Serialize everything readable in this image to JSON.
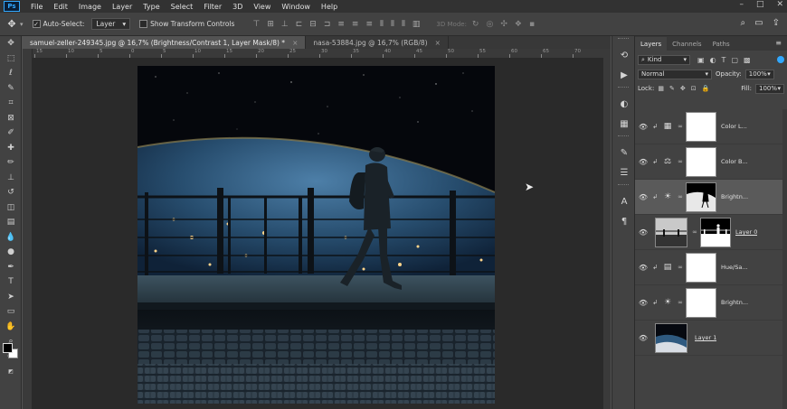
{
  "app": {
    "menu": [
      "File",
      "Edit",
      "Image",
      "Layer",
      "Type",
      "Select",
      "Filter",
      "3D",
      "View",
      "Window",
      "Help"
    ],
    "logo": "Ps"
  },
  "options": {
    "auto_select_label": "Auto-Select:",
    "auto_select_value": "Layer",
    "show_transform_label": "Show Transform Controls",
    "mode_3d_label": "3D Mode:"
  },
  "tabs": [
    {
      "label": "samuel-zeller-249345.jpg @ 16,7% (Brightness/Contrast 1, Layer Mask/8) *",
      "close": "×"
    },
    {
      "label": "nasa-53884.jpg @ 16,7% (RGB/8)",
      "close": "×"
    }
  ],
  "ruler": [
    "15",
    "10",
    "5",
    "0",
    "5",
    "10",
    "15",
    "20",
    "25",
    "30",
    "35",
    "40",
    "45",
    "50",
    "55",
    "60",
    "65",
    "70",
    "75"
  ],
  "panel": {
    "tabs": [
      "Layers",
      "Channels",
      "Paths"
    ],
    "filter_kind": "Kind",
    "blend_mode": "Normal",
    "opacity_label": "Opacity:",
    "opacity_value": "100%",
    "lock_label": "Lock:",
    "fill_label": "Fill:",
    "fill_value": "100%"
  },
  "layers": [
    {
      "name": "Color L...",
      "type": "adjustment",
      "icon": "color-lookup-icon",
      "clipped": true
    },
    {
      "name": "Color B...",
      "type": "adjustment",
      "icon": "color-balance-icon",
      "clipped": true
    },
    {
      "name": "Brightn...",
      "type": "adjustment",
      "icon": "brightness-icon",
      "clipped": true,
      "selected": true
    },
    {
      "name": "Layer 0",
      "type": "pixel",
      "icon": "",
      "clipped": false
    },
    {
      "name": "Hue/Sa...",
      "type": "adjustment",
      "icon": "hue-saturation-icon",
      "clipped": true
    },
    {
      "name": "Brightn...",
      "type": "adjustment",
      "icon": "brightness-icon",
      "clipped": true
    },
    {
      "name": "Layer 1",
      "type": "pixel",
      "icon": "",
      "clipped": false
    }
  ]
}
